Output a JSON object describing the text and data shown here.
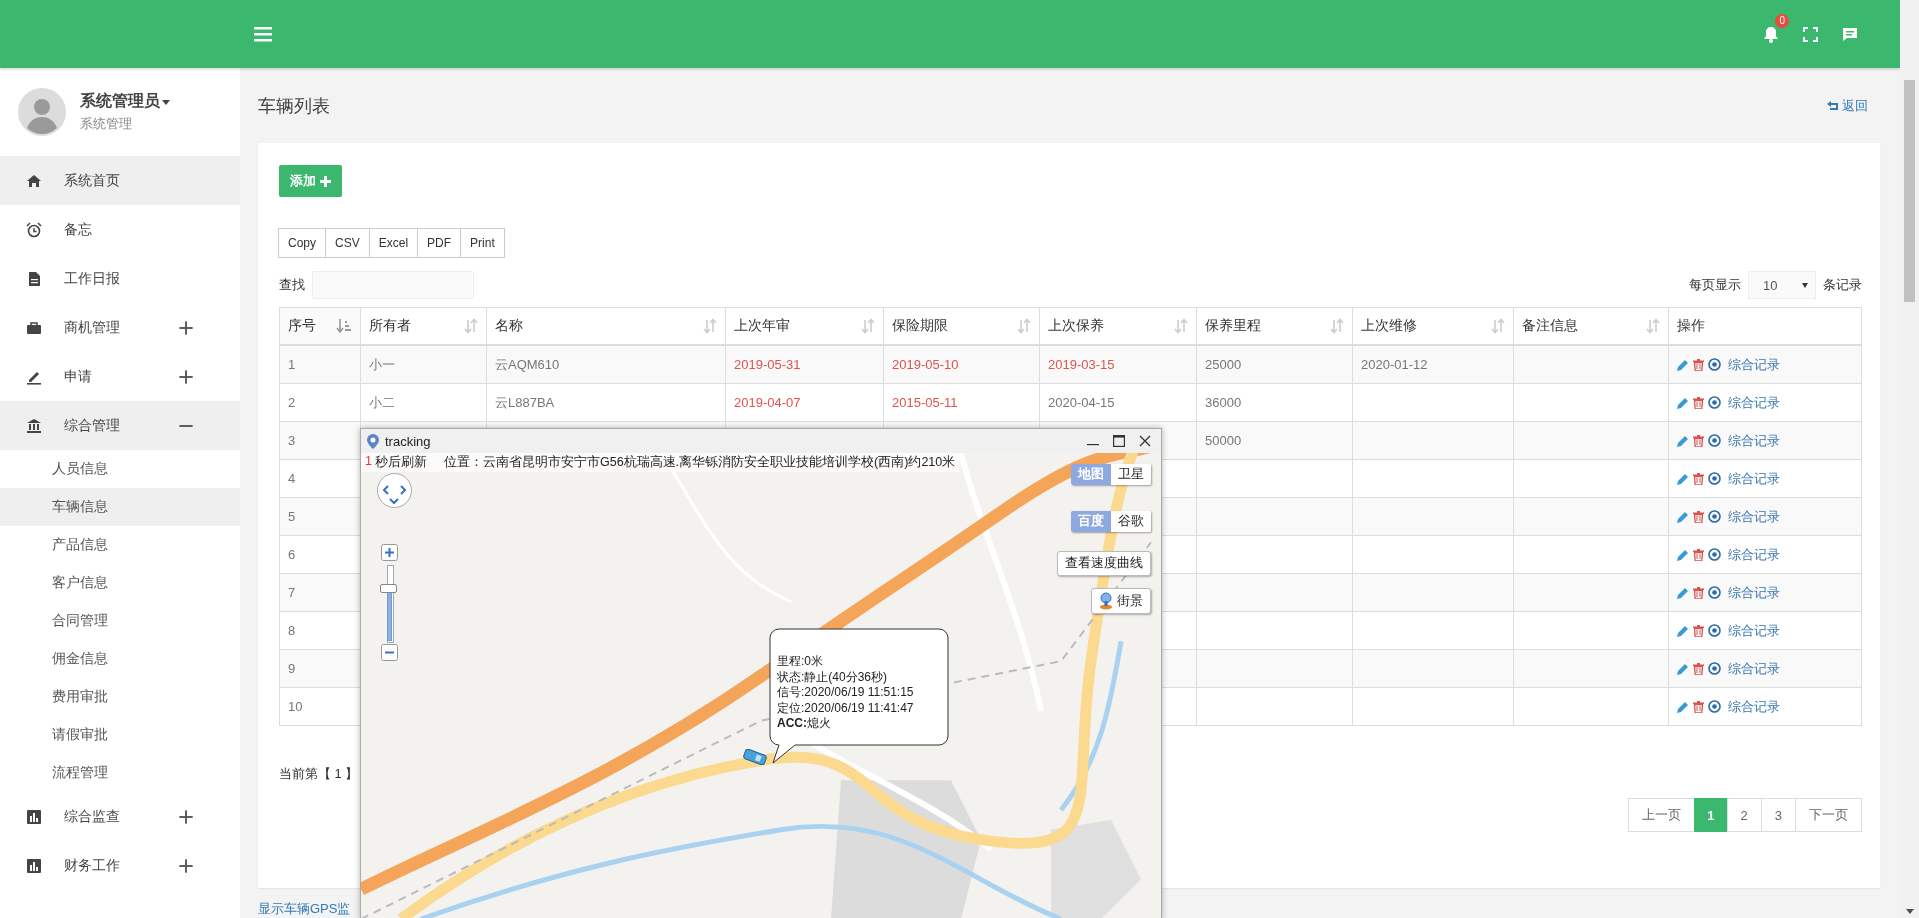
{
  "header": {
    "notification_count": "0"
  },
  "user": {
    "name": "系统管理员",
    "role": "系统管理"
  },
  "sidebar": {
    "items": [
      {
        "kind": "link",
        "label": "系统首页",
        "selected": true
      },
      {
        "kind": "link",
        "label": "备忘",
        "selected": false
      },
      {
        "kind": "link",
        "label": "工作日报",
        "selected": false
      },
      {
        "kind": "group",
        "label": "商机管理",
        "expanded": false
      },
      {
        "kind": "group",
        "label": "申请",
        "expanded": false
      },
      {
        "kind": "group",
        "label": "综合管理",
        "expanded": true,
        "children": [
          {
            "label": "人员信息",
            "selected": false
          },
          {
            "label": "车辆信息",
            "selected": true
          },
          {
            "label": "产品信息",
            "selected": false
          },
          {
            "label": "客户信息",
            "selected": false
          },
          {
            "label": "合同管理",
            "selected": false
          },
          {
            "label": "佣金信息",
            "selected": false
          },
          {
            "label": "费用审批",
            "selected": false
          },
          {
            "label": "请假审批",
            "selected": false
          },
          {
            "label": "流程管理",
            "selected": false
          }
        ]
      },
      {
        "kind": "group",
        "label": "综合监查",
        "expanded": false
      },
      {
        "kind": "group",
        "label": "财务工作",
        "expanded": false
      }
    ]
  },
  "page": {
    "title": "车辆列表",
    "back": "返回",
    "add_button": "添加",
    "export_buttons": [
      "Copy",
      "CSV",
      "Excel",
      "PDF",
      "Print"
    ],
    "search_label": "查找",
    "page_size_label": "每页显示",
    "page_size": "10",
    "page_size_suffix": "条记录"
  },
  "table": {
    "columns": [
      {
        "label": "序号",
        "sortable": true,
        "sorted": true
      },
      {
        "label": "所有者",
        "sortable": true,
        "sorted": false
      },
      {
        "label": "名称",
        "sortable": true,
        "sorted": false
      },
      {
        "label": "上次年审",
        "sortable": true,
        "sorted": false
      },
      {
        "label": "保险期限",
        "sortable": true,
        "sorted": false
      },
      {
        "label": "上次保养",
        "sortable": true,
        "sorted": false
      },
      {
        "label": "保养里程",
        "sortable": true,
        "sorted": false
      },
      {
        "label": "上次维修",
        "sortable": true,
        "sorted": false
      },
      {
        "label": "备注信息",
        "sortable": true,
        "sorted": false
      },
      {
        "label": "操作",
        "sortable": false
      }
    ],
    "rows": [
      {
        "cells": [
          {
            "text": "1",
            "overdue": false
          },
          {
            "text": "小一",
            "overdue": false
          },
          {
            "text": "云AQM610",
            "overdue": false
          },
          {
            "text": "2019-05-31",
            "overdue": true
          },
          {
            "text": "2019-05-10",
            "overdue": true
          },
          {
            "text": "2019-03-15",
            "overdue": true
          },
          {
            "text": "25000",
            "overdue": false
          },
          {
            "text": "2020-01-12",
            "overdue": false
          },
          null
        ],
        "action": "综合记录"
      },
      {
        "cells": [
          {
            "text": "2",
            "overdue": false
          },
          {
            "text": "小二",
            "overdue": false
          },
          {
            "text": "云L887BA",
            "overdue": false
          },
          {
            "text": "2019-04-07",
            "overdue": true
          },
          {
            "text": "2015-05-11",
            "overdue": true
          },
          {
            "text": "2020-04-15",
            "overdue": false
          },
          {
            "text": "36000",
            "overdue": false
          },
          null,
          null
        ],
        "action": "综合记录"
      },
      {
        "cells": [
          {
            "text": "3",
            "overdue": false
          },
          null,
          null,
          null,
          null,
          null,
          {
            "text": "50000",
            "overdue": false
          },
          null,
          null
        ],
        "action": "综合记录"
      },
      {
        "cells": [
          {
            "text": "4",
            "overdue": false
          },
          null,
          null,
          null,
          null,
          null,
          null,
          null,
          null
        ],
        "action": "综合记录"
      },
      {
        "cells": [
          {
            "text": "5",
            "overdue": false
          },
          null,
          null,
          null,
          null,
          null,
          null,
          null,
          null
        ],
        "action": "综合记录"
      },
      {
        "cells": [
          {
            "text": "6",
            "overdue": false
          },
          null,
          null,
          null,
          null,
          null,
          null,
          null,
          null
        ],
        "action": "综合记录"
      },
      {
        "cells": [
          {
            "text": "7",
            "overdue": false
          },
          null,
          null,
          null,
          null,
          null,
          null,
          null,
          null
        ],
        "action": "综合记录"
      },
      {
        "cells": [
          {
            "text": "8",
            "overdue": false
          },
          null,
          null,
          null,
          null,
          null,
          null,
          null,
          null
        ],
        "action": "综合记录"
      },
      {
        "cells": [
          {
            "text": "9",
            "overdue": false
          },
          null,
          null,
          null,
          null,
          null,
          null,
          null,
          null
        ],
        "action": "综合记录"
      },
      {
        "cells": [
          {
            "text": "10",
            "overdue": false
          },
          null,
          null,
          null,
          null,
          null,
          null,
          null,
          null
        ],
        "action": "综合记录"
      }
    ]
  },
  "pagination": {
    "info": "当前第【 1 】",
    "previous": "上一页",
    "pages": [
      {
        "label": "1",
        "selected": true
      },
      {
        "label": "2",
        "selected": false
      },
      {
        "label": "3",
        "selected": false
      }
    ],
    "next": "下一页"
  },
  "footer_link": "显示车辆GPS监",
  "tracking": {
    "title": "tracking",
    "refresh_count": "1",
    "refresh_label": "秒后刷新",
    "location": "位置：云南省昆明市安宁市G56杭瑞高速.离华铄消防安全职业技能培训学校(西南)约210米",
    "zoom": {
      "level": 0.68
    },
    "map_type": [
      {
        "label": "地图",
        "selected": true
      },
      {
        "label": "卫星",
        "selected": false
      }
    ],
    "map_source": [
      {
        "label": "百度",
        "selected": true
      },
      {
        "label": "谷歌",
        "selected": false
      }
    ],
    "speed_button": "查看速度曲线",
    "street_view": "街景",
    "info_lines": [
      "里程:0米",
      "状态:静止(40分36秒)",
      "信号:2020/06/19 11:51:15",
      "定位:2020/06/19 11:41:47",
      "**ACC:**熄火"
    ]
  }
}
